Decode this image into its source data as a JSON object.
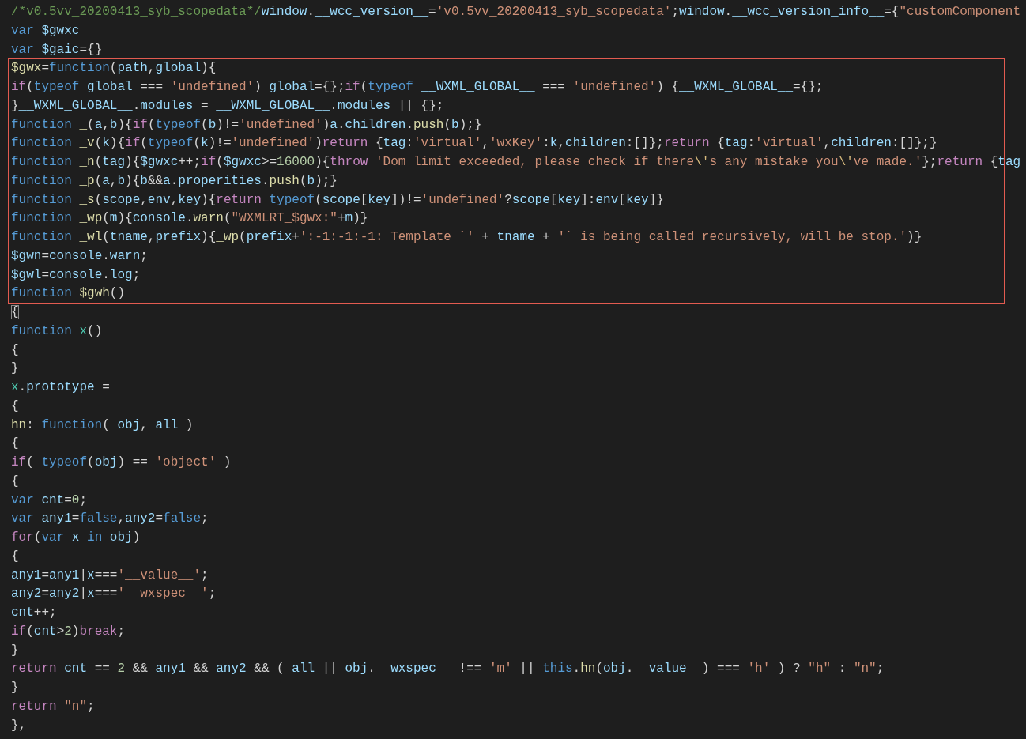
{
  "editor": {
    "top_lines": [
      {
        "current": false,
        "tokens": [
          {
            "kind": "comment",
            "text": "/*v0.5vv_20200413_syb_scopedata*/"
          },
          {
            "kind": "variable",
            "text": "window"
          },
          {
            "kind": "plain",
            "text": "."
          },
          {
            "kind": "variable",
            "text": "__wcc_version__"
          },
          {
            "kind": "plain",
            "text": "="
          },
          {
            "kind": "string",
            "text": "'v0.5vv_20200413_syb_scopedata'"
          },
          {
            "kind": "plain",
            "text": ";"
          },
          {
            "kind": "variable",
            "text": "window"
          },
          {
            "kind": "plain",
            "text": "."
          },
          {
            "kind": "variable",
            "text": "__wcc_version_info__"
          },
          {
            "kind": "plain",
            "text": "={"
          },
          {
            "kind": "string",
            "text": "\"customComponent"
          }
        ]
      },
      {
        "current": false,
        "tokens": [
          {
            "kind": "keyword",
            "text": "var "
          },
          {
            "kind": "variable",
            "text": "$gwxc"
          }
        ]
      },
      {
        "current": false,
        "tokens": [
          {
            "kind": "keyword",
            "text": "var "
          },
          {
            "kind": "variable",
            "text": "$gaic"
          },
          {
            "kind": "plain",
            "text": "={}"
          }
        ]
      }
    ],
    "boxed_lines": [
      {
        "current": false,
        "tokens": [
          {
            "kind": "function",
            "text": "$gwx"
          },
          {
            "kind": "plain",
            "text": "="
          },
          {
            "kind": "keyword",
            "text": "function"
          },
          {
            "kind": "plain",
            "text": "("
          },
          {
            "kind": "variable",
            "text": "path"
          },
          {
            "kind": "plain",
            "text": ","
          },
          {
            "kind": "variable",
            "text": "global"
          },
          {
            "kind": "plain",
            "text": "){"
          }
        ]
      },
      {
        "current": false,
        "tokens": [
          {
            "kind": "control",
            "text": "if"
          },
          {
            "kind": "plain",
            "text": "("
          },
          {
            "kind": "keyword",
            "text": "typeof "
          },
          {
            "kind": "variable",
            "text": "global"
          },
          {
            "kind": "plain",
            "text": " === "
          },
          {
            "kind": "string",
            "text": "'undefined'"
          },
          {
            "kind": "plain",
            "text": ") "
          },
          {
            "kind": "variable",
            "text": "global"
          },
          {
            "kind": "plain",
            "text": "={};"
          },
          {
            "kind": "control",
            "text": "if"
          },
          {
            "kind": "plain",
            "text": "("
          },
          {
            "kind": "keyword",
            "text": "typeof "
          },
          {
            "kind": "variable",
            "text": "__WXML_GLOBAL__"
          },
          {
            "kind": "plain",
            "text": " === "
          },
          {
            "kind": "string",
            "text": "'undefined'"
          },
          {
            "kind": "plain",
            "text": ") {"
          },
          {
            "kind": "variable",
            "text": "__WXML_GLOBAL__"
          },
          {
            "kind": "plain",
            "text": "={};"
          }
        ]
      },
      {
        "current": false,
        "tokens": [
          {
            "kind": "plain",
            "text": "}"
          },
          {
            "kind": "variable",
            "text": "__WXML_GLOBAL__"
          },
          {
            "kind": "plain",
            "text": "."
          },
          {
            "kind": "variable",
            "text": "modules"
          },
          {
            "kind": "plain",
            "text": " = "
          },
          {
            "kind": "variable",
            "text": "__WXML_GLOBAL__"
          },
          {
            "kind": "plain",
            "text": "."
          },
          {
            "kind": "variable",
            "text": "modules"
          },
          {
            "kind": "plain",
            "text": " || {};"
          }
        ]
      },
      {
        "current": false,
        "tokens": [
          {
            "kind": "keyword",
            "text": "function "
          },
          {
            "kind": "function",
            "text": "_"
          },
          {
            "kind": "plain",
            "text": "("
          },
          {
            "kind": "variable",
            "text": "a"
          },
          {
            "kind": "plain",
            "text": ","
          },
          {
            "kind": "variable",
            "text": "b"
          },
          {
            "kind": "plain",
            "text": "){"
          },
          {
            "kind": "control",
            "text": "if"
          },
          {
            "kind": "plain",
            "text": "("
          },
          {
            "kind": "keyword",
            "text": "typeof"
          },
          {
            "kind": "plain",
            "text": "("
          },
          {
            "kind": "variable",
            "text": "b"
          },
          {
            "kind": "plain",
            "text": ")!="
          },
          {
            "kind": "string",
            "text": "'undefined'"
          },
          {
            "kind": "plain",
            "text": ")"
          },
          {
            "kind": "variable",
            "text": "a"
          },
          {
            "kind": "plain",
            "text": "."
          },
          {
            "kind": "variable",
            "text": "children"
          },
          {
            "kind": "plain",
            "text": "."
          },
          {
            "kind": "function",
            "text": "push"
          },
          {
            "kind": "plain",
            "text": "("
          },
          {
            "kind": "variable",
            "text": "b"
          },
          {
            "kind": "plain",
            "text": ");}"
          }
        ]
      },
      {
        "current": false,
        "tokens": [
          {
            "kind": "keyword",
            "text": "function "
          },
          {
            "kind": "function",
            "text": "_v"
          },
          {
            "kind": "plain",
            "text": "("
          },
          {
            "kind": "variable",
            "text": "k"
          },
          {
            "kind": "plain",
            "text": "){"
          },
          {
            "kind": "control",
            "text": "if"
          },
          {
            "kind": "plain",
            "text": "("
          },
          {
            "kind": "keyword",
            "text": "typeof"
          },
          {
            "kind": "plain",
            "text": "("
          },
          {
            "kind": "variable",
            "text": "k"
          },
          {
            "kind": "plain",
            "text": ")!="
          },
          {
            "kind": "string",
            "text": "'undefined'"
          },
          {
            "kind": "plain",
            "text": ")"
          },
          {
            "kind": "control",
            "text": "return"
          },
          {
            "kind": "plain",
            "text": " {"
          },
          {
            "kind": "variable",
            "text": "tag"
          },
          {
            "kind": "plain",
            "text": ":"
          },
          {
            "kind": "string",
            "text": "'virtual'"
          },
          {
            "kind": "plain",
            "text": ","
          },
          {
            "kind": "string",
            "text": "'wxKey'"
          },
          {
            "kind": "plain",
            "text": ":"
          },
          {
            "kind": "variable",
            "text": "k"
          },
          {
            "kind": "plain",
            "text": ","
          },
          {
            "kind": "variable",
            "text": "children"
          },
          {
            "kind": "plain",
            "text": ":[]};"
          },
          {
            "kind": "control",
            "text": "return"
          },
          {
            "kind": "plain",
            "text": " {"
          },
          {
            "kind": "variable",
            "text": "tag"
          },
          {
            "kind": "plain",
            "text": ":"
          },
          {
            "kind": "string",
            "text": "'virtual'"
          },
          {
            "kind": "plain",
            "text": ","
          },
          {
            "kind": "variable",
            "text": "children"
          },
          {
            "kind": "plain",
            "text": ":[]};}"
          }
        ]
      },
      {
        "current": false,
        "tokens": [
          {
            "kind": "keyword",
            "text": "function "
          },
          {
            "kind": "function",
            "text": "_n"
          },
          {
            "kind": "plain",
            "text": "("
          },
          {
            "kind": "variable",
            "text": "tag"
          },
          {
            "kind": "plain",
            "text": "){"
          },
          {
            "kind": "variable",
            "text": "$gwxc"
          },
          {
            "kind": "plain",
            "text": "++;"
          },
          {
            "kind": "control",
            "text": "if"
          },
          {
            "kind": "plain",
            "text": "("
          },
          {
            "kind": "variable",
            "text": "$gwxc"
          },
          {
            "kind": "plain",
            "text": ">="
          },
          {
            "kind": "number",
            "text": "16000"
          },
          {
            "kind": "plain",
            "text": "){"
          },
          {
            "kind": "control",
            "text": "throw "
          },
          {
            "kind": "string",
            "text": "'Dom limit exceeded, please check if there"
          },
          {
            "kind": "escape",
            "text": "\\'"
          },
          {
            "kind": "string",
            "text": "s any mistake you"
          },
          {
            "kind": "escape",
            "text": "\\'"
          },
          {
            "kind": "string",
            "text": "ve made.'"
          },
          {
            "kind": "plain",
            "text": "};"
          },
          {
            "kind": "control",
            "text": "return"
          },
          {
            "kind": "plain",
            "text": " {"
          },
          {
            "kind": "variable",
            "text": "tag"
          }
        ]
      },
      {
        "current": false,
        "tokens": [
          {
            "kind": "keyword",
            "text": "function "
          },
          {
            "kind": "function",
            "text": "_p"
          },
          {
            "kind": "plain",
            "text": "("
          },
          {
            "kind": "variable",
            "text": "a"
          },
          {
            "kind": "plain",
            "text": ","
          },
          {
            "kind": "variable",
            "text": "b"
          },
          {
            "kind": "plain",
            "text": "){"
          },
          {
            "kind": "variable",
            "text": "b"
          },
          {
            "kind": "plain",
            "text": "&&"
          },
          {
            "kind": "variable",
            "text": "a"
          },
          {
            "kind": "plain",
            "text": "."
          },
          {
            "kind": "variable",
            "text": "properities"
          },
          {
            "kind": "plain",
            "text": "."
          },
          {
            "kind": "function",
            "text": "push"
          },
          {
            "kind": "plain",
            "text": "("
          },
          {
            "kind": "variable",
            "text": "b"
          },
          {
            "kind": "plain",
            "text": ");}"
          }
        ]
      },
      {
        "current": false,
        "tokens": [
          {
            "kind": "keyword",
            "text": "function "
          },
          {
            "kind": "function",
            "text": "_s"
          },
          {
            "kind": "plain",
            "text": "("
          },
          {
            "kind": "variable",
            "text": "scope"
          },
          {
            "kind": "plain",
            "text": ","
          },
          {
            "kind": "variable",
            "text": "env"
          },
          {
            "kind": "plain",
            "text": ","
          },
          {
            "kind": "variable",
            "text": "key"
          },
          {
            "kind": "plain",
            "text": "){"
          },
          {
            "kind": "control",
            "text": "return "
          },
          {
            "kind": "keyword",
            "text": "typeof"
          },
          {
            "kind": "plain",
            "text": "("
          },
          {
            "kind": "variable",
            "text": "scope"
          },
          {
            "kind": "plain",
            "text": "["
          },
          {
            "kind": "variable",
            "text": "key"
          },
          {
            "kind": "plain",
            "text": "])!="
          },
          {
            "kind": "string",
            "text": "'undefined'"
          },
          {
            "kind": "plain",
            "text": "?"
          },
          {
            "kind": "variable",
            "text": "scope"
          },
          {
            "kind": "plain",
            "text": "["
          },
          {
            "kind": "variable",
            "text": "key"
          },
          {
            "kind": "plain",
            "text": "]:"
          },
          {
            "kind": "variable",
            "text": "env"
          },
          {
            "kind": "plain",
            "text": "["
          },
          {
            "kind": "variable",
            "text": "key"
          },
          {
            "kind": "plain",
            "text": "]}"
          }
        ]
      },
      {
        "current": false,
        "tokens": [
          {
            "kind": "keyword",
            "text": "function "
          },
          {
            "kind": "function",
            "text": "_wp"
          },
          {
            "kind": "plain",
            "text": "("
          },
          {
            "kind": "variable",
            "text": "m"
          },
          {
            "kind": "plain",
            "text": "){"
          },
          {
            "kind": "variable",
            "text": "console"
          },
          {
            "kind": "plain",
            "text": "."
          },
          {
            "kind": "function",
            "text": "warn"
          },
          {
            "kind": "plain",
            "text": "("
          },
          {
            "kind": "string",
            "text": "\"WXMLRT_$gwx:\""
          },
          {
            "kind": "plain",
            "text": "+"
          },
          {
            "kind": "variable",
            "text": "m"
          },
          {
            "kind": "plain",
            "text": ")}"
          }
        ]
      },
      {
        "current": false,
        "tokens": [
          {
            "kind": "keyword",
            "text": "function "
          },
          {
            "kind": "function",
            "text": "_wl"
          },
          {
            "kind": "plain",
            "text": "("
          },
          {
            "kind": "variable",
            "text": "tname"
          },
          {
            "kind": "plain",
            "text": ","
          },
          {
            "kind": "variable",
            "text": "prefix"
          },
          {
            "kind": "plain",
            "text": "){"
          },
          {
            "kind": "function",
            "text": "_wp"
          },
          {
            "kind": "plain",
            "text": "("
          },
          {
            "kind": "variable",
            "text": "prefix"
          },
          {
            "kind": "plain",
            "text": "+"
          },
          {
            "kind": "string",
            "text": "':-1:-1:-1: Template `'"
          },
          {
            "kind": "plain",
            "text": " + "
          },
          {
            "kind": "variable",
            "text": "tname"
          },
          {
            "kind": "plain",
            "text": " + "
          },
          {
            "kind": "string",
            "text": "'` is being called recursively, will be stop.'"
          },
          {
            "kind": "plain",
            "text": ")}"
          }
        ]
      },
      {
        "current": false,
        "tokens": [
          {
            "kind": "variable",
            "text": "$gwn"
          },
          {
            "kind": "plain",
            "text": "="
          },
          {
            "kind": "variable",
            "text": "console"
          },
          {
            "kind": "plain",
            "text": "."
          },
          {
            "kind": "variable",
            "text": "warn"
          },
          {
            "kind": "plain",
            "text": ";"
          }
        ]
      },
      {
        "current": false,
        "tokens": [
          {
            "kind": "variable",
            "text": "$gwl"
          },
          {
            "kind": "plain",
            "text": "="
          },
          {
            "kind": "variable",
            "text": "console"
          },
          {
            "kind": "plain",
            "text": "."
          },
          {
            "kind": "variable",
            "text": "log"
          },
          {
            "kind": "plain",
            "text": ";"
          }
        ]
      },
      {
        "current": false,
        "tokens": [
          {
            "kind": "keyword",
            "text": "function "
          },
          {
            "kind": "function",
            "text": "$gwh"
          },
          {
            "kind": "plain",
            "text": "()"
          }
        ]
      }
    ],
    "bottom_lines": [
      {
        "current": true,
        "tokens": [
          {
            "kind": "bracket",
            "text": "{"
          }
        ]
      },
      {
        "current": false,
        "tokens": [
          {
            "kind": "keyword",
            "text": "function "
          },
          {
            "kind": "type",
            "text": "x"
          },
          {
            "kind": "plain",
            "text": "()"
          }
        ]
      },
      {
        "current": false,
        "tokens": [
          {
            "kind": "plain",
            "text": "{"
          }
        ]
      },
      {
        "current": false,
        "tokens": [
          {
            "kind": "plain",
            "text": "}"
          }
        ]
      },
      {
        "current": false,
        "tokens": [
          {
            "kind": "type",
            "text": "x"
          },
          {
            "kind": "plain",
            "text": "."
          },
          {
            "kind": "variable",
            "text": "prototype"
          },
          {
            "kind": "plain",
            "text": " ="
          }
        ]
      },
      {
        "current": false,
        "tokens": [
          {
            "kind": "plain",
            "text": "{"
          }
        ]
      },
      {
        "current": false,
        "tokens": [
          {
            "kind": "function",
            "text": "hn"
          },
          {
            "kind": "plain",
            "text": ": "
          },
          {
            "kind": "keyword",
            "text": "function"
          },
          {
            "kind": "plain",
            "text": "( "
          },
          {
            "kind": "variable",
            "text": "obj"
          },
          {
            "kind": "plain",
            "text": ", "
          },
          {
            "kind": "variable",
            "text": "all"
          },
          {
            "kind": "plain",
            "text": " )"
          }
        ]
      },
      {
        "current": false,
        "tokens": [
          {
            "kind": "plain",
            "text": "{"
          }
        ]
      },
      {
        "current": false,
        "tokens": [
          {
            "kind": "control",
            "text": "if"
          },
          {
            "kind": "plain",
            "text": "( "
          },
          {
            "kind": "keyword",
            "text": "typeof"
          },
          {
            "kind": "plain",
            "text": "("
          },
          {
            "kind": "variable",
            "text": "obj"
          },
          {
            "kind": "plain",
            "text": ") == "
          },
          {
            "kind": "string",
            "text": "'object'"
          },
          {
            "kind": "plain",
            "text": " )"
          }
        ]
      },
      {
        "current": false,
        "tokens": [
          {
            "kind": "plain",
            "text": "{"
          }
        ]
      },
      {
        "current": false,
        "tokens": [
          {
            "kind": "keyword",
            "text": "var "
          },
          {
            "kind": "variable",
            "text": "cnt"
          },
          {
            "kind": "plain",
            "text": "="
          },
          {
            "kind": "number",
            "text": "0"
          },
          {
            "kind": "plain",
            "text": ";"
          }
        ]
      },
      {
        "current": false,
        "tokens": [
          {
            "kind": "keyword",
            "text": "var "
          },
          {
            "kind": "variable",
            "text": "any1"
          },
          {
            "kind": "plain",
            "text": "="
          },
          {
            "kind": "keyword",
            "text": "false"
          },
          {
            "kind": "plain",
            "text": ","
          },
          {
            "kind": "variable",
            "text": "any2"
          },
          {
            "kind": "plain",
            "text": "="
          },
          {
            "kind": "keyword",
            "text": "false"
          },
          {
            "kind": "plain",
            "text": ";"
          }
        ]
      },
      {
        "current": false,
        "tokens": [
          {
            "kind": "control",
            "text": "for"
          },
          {
            "kind": "plain",
            "text": "("
          },
          {
            "kind": "keyword",
            "text": "var "
          },
          {
            "kind": "variable",
            "text": "x "
          },
          {
            "kind": "keyword",
            "text": "in "
          },
          {
            "kind": "variable",
            "text": "obj"
          },
          {
            "kind": "plain",
            "text": ")"
          }
        ]
      },
      {
        "current": false,
        "tokens": [
          {
            "kind": "plain",
            "text": "{"
          }
        ]
      },
      {
        "current": false,
        "tokens": [
          {
            "kind": "variable",
            "text": "any1"
          },
          {
            "kind": "plain",
            "text": "="
          },
          {
            "kind": "variable",
            "text": "any1"
          },
          {
            "kind": "plain",
            "text": "|"
          },
          {
            "kind": "variable",
            "text": "x"
          },
          {
            "kind": "plain",
            "text": "==="
          },
          {
            "kind": "string",
            "text": "'__value__'"
          },
          {
            "kind": "plain",
            "text": ";"
          }
        ]
      },
      {
        "current": false,
        "tokens": [
          {
            "kind": "variable",
            "text": "any2"
          },
          {
            "kind": "plain",
            "text": "="
          },
          {
            "kind": "variable",
            "text": "any2"
          },
          {
            "kind": "plain",
            "text": "|"
          },
          {
            "kind": "variable",
            "text": "x"
          },
          {
            "kind": "plain",
            "text": "==="
          },
          {
            "kind": "string",
            "text": "'__wxspec__'"
          },
          {
            "kind": "plain",
            "text": ";"
          }
        ]
      },
      {
        "current": false,
        "tokens": [
          {
            "kind": "variable",
            "text": "cnt"
          },
          {
            "kind": "plain",
            "text": "++;"
          }
        ]
      },
      {
        "current": false,
        "tokens": [
          {
            "kind": "control",
            "text": "if"
          },
          {
            "kind": "plain",
            "text": "("
          },
          {
            "kind": "variable",
            "text": "cnt"
          },
          {
            "kind": "plain",
            "text": ">"
          },
          {
            "kind": "number",
            "text": "2"
          },
          {
            "kind": "plain",
            "text": ")"
          },
          {
            "kind": "control",
            "text": "break"
          },
          {
            "kind": "plain",
            "text": ";"
          }
        ]
      },
      {
        "current": false,
        "tokens": [
          {
            "kind": "plain",
            "text": "}"
          }
        ]
      },
      {
        "current": false,
        "tokens": [
          {
            "kind": "control",
            "text": "return "
          },
          {
            "kind": "variable",
            "text": "cnt"
          },
          {
            "kind": "plain",
            "text": " == "
          },
          {
            "kind": "number",
            "text": "2"
          },
          {
            "kind": "plain",
            "text": " && "
          },
          {
            "kind": "variable",
            "text": "any1"
          },
          {
            "kind": "plain",
            "text": " && "
          },
          {
            "kind": "variable",
            "text": "any2"
          },
          {
            "kind": "plain",
            "text": " && ( "
          },
          {
            "kind": "variable",
            "text": "all"
          },
          {
            "kind": "plain",
            "text": " || "
          },
          {
            "kind": "variable",
            "text": "obj"
          },
          {
            "kind": "plain",
            "text": "."
          },
          {
            "kind": "variable",
            "text": "__wxspec__"
          },
          {
            "kind": "plain",
            "text": " !== "
          },
          {
            "kind": "string",
            "text": "'m'"
          },
          {
            "kind": "plain",
            "text": " || "
          },
          {
            "kind": "keyword",
            "text": "this"
          },
          {
            "kind": "plain",
            "text": "."
          },
          {
            "kind": "function",
            "text": "hn"
          },
          {
            "kind": "plain",
            "text": "("
          },
          {
            "kind": "variable",
            "text": "obj"
          },
          {
            "kind": "plain",
            "text": "."
          },
          {
            "kind": "variable",
            "text": "__value__"
          },
          {
            "kind": "plain",
            "text": ") === "
          },
          {
            "kind": "string",
            "text": "'h'"
          },
          {
            "kind": "plain",
            "text": " ) ? "
          },
          {
            "kind": "string",
            "text": "\"h\""
          },
          {
            "kind": "plain",
            "text": " : "
          },
          {
            "kind": "string",
            "text": "\"n\""
          },
          {
            "kind": "plain",
            "text": ";"
          }
        ]
      },
      {
        "current": false,
        "tokens": [
          {
            "kind": "plain",
            "text": "}"
          }
        ]
      },
      {
        "current": false,
        "tokens": [
          {
            "kind": "control",
            "text": "return "
          },
          {
            "kind": "string",
            "text": "\"n\""
          },
          {
            "kind": "plain",
            "text": ";"
          }
        ]
      },
      {
        "current": false,
        "tokens": [
          {
            "kind": "plain",
            "text": "},"
          }
        ]
      }
    ]
  }
}
